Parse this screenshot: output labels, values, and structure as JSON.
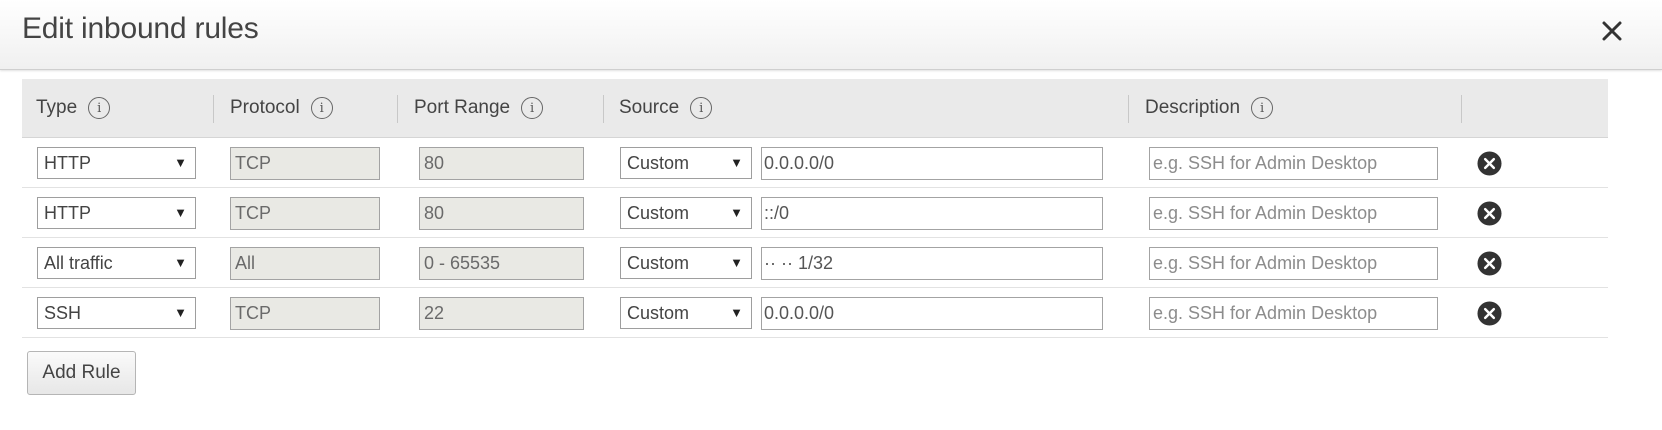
{
  "dialog": {
    "title": "Edit inbound rules",
    "close_icon": "close-icon"
  },
  "columns": {
    "type": "Type",
    "protocol": "Protocol",
    "port_range": "Port Range",
    "source": "Source",
    "description": "Description",
    "info_glyph": "i"
  },
  "rules": [
    {
      "type": "HTTP",
      "protocol": "TCP",
      "port_range": "80",
      "source_type": "Custom",
      "source_value": "0.0.0.0/0",
      "description_placeholder": "e.g. SSH for Admin Desktop"
    },
    {
      "type": "HTTP",
      "protocol": "TCP",
      "port_range": "80",
      "source_type": "Custom",
      "source_value": "::/0",
      "description_placeholder": "e.g. SSH for Admin Desktop"
    },
    {
      "type": "All traffic",
      "protocol": "All",
      "port_range": "0 - 65535",
      "source_type": "Custom",
      "source_value": "·· ·· 1/32",
      "description_placeholder": "e.g. SSH for Admin Desktop"
    },
    {
      "type": "SSH",
      "protocol": "TCP",
      "port_range": "22",
      "source_type": "Custom",
      "source_value": "0.0.0.0/0",
      "description_placeholder": "e.g. SSH for Admin Desktop"
    }
  ],
  "actions": {
    "add_rule_label": "Add Rule",
    "dropdown_caret": "▼"
  },
  "colors": {
    "header_bg": "#eaeaea",
    "readonly_bg": "#e9e9e4",
    "remove_icon": "#333333"
  }
}
